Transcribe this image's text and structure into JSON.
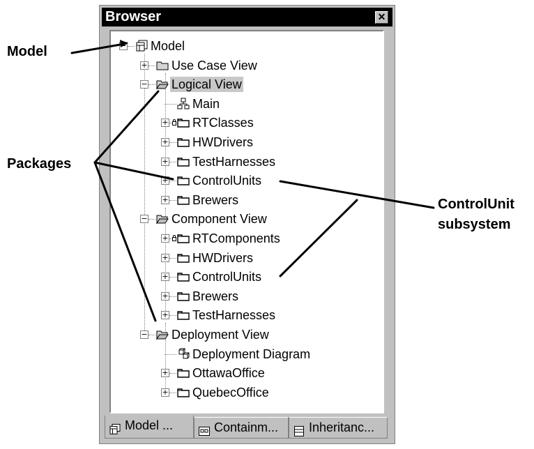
{
  "window": {
    "title": "Browser",
    "close_glyph": "✕"
  },
  "tree": [
    {
      "label": "Model",
      "icon": "model-icon",
      "depth": 0,
      "expander": "−",
      "selected": false
    },
    {
      "label": "Use Case View",
      "icon": "folder-icon",
      "depth": 1,
      "expander": "+",
      "selected": false
    },
    {
      "label": "Logical View",
      "icon": "folder-open-icon",
      "depth": 1,
      "expander": "−",
      "selected": true
    },
    {
      "label": "Main",
      "icon": "class-diagram-icon",
      "depth": 2,
      "expander": "",
      "selected": false
    },
    {
      "label": "RTClasses",
      "icon": "package-icon",
      "depth": 2,
      "expander": "+",
      "selected": false,
      "locked": true
    },
    {
      "label": "HWDrivers",
      "icon": "package-icon",
      "depth": 2,
      "expander": "+",
      "selected": false
    },
    {
      "label": "TestHarnesses",
      "icon": "package-icon",
      "depth": 2,
      "expander": "+",
      "selected": false
    },
    {
      "label": "ControlUnits",
      "icon": "package-icon",
      "depth": 2,
      "expander": "+",
      "selected": false
    },
    {
      "label": "Brewers",
      "icon": "package-icon",
      "depth": 2,
      "expander": "+",
      "selected": false
    },
    {
      "label": "Component View",
      "icon": "folder-open-icon",
      "depth": 1,
      "expander": "−",
      "selected": false
    },
    {
      "label": "RTComponents",
      "icon": "package-icon",
      "depth": 2,
      "expander": "+",
      "selected": false,
      "locked": true
    },
    {
      "label": "HWDrivers",
      "icon": "package-icon",
      "depth": 2,
      "expander": "+",
      "selected": false
    },
    {
      "label": "ControlUnits",
      "icon": "package-icon",
      "depth": 2,
      "expander": "+",
      "selected": false
    },
    {
      "label": "Brewers",
      "icon": "package-icon",
      "depth": 2,
      "expander": "+",
      "selected": false
    },
    {
      "label": "TestHarnesses",
      "icon": "package-icon",
      "depth": 2,
      "expander": "+",
      "selected": false
    },
    {
      "label": "Deployment View",
      "icon": "folder-open-icon",
      "depth": 1,
      "expander": "−",
      "selected": false
    },
    {
      "label": "Deployment Diagram",
      "icon": "deployment-diagram-icon",
      "depth": 2,
      "expander": "",
      "selected": false
    },
    {
      "label": "OttawaOffice",
      "icon": "package-icon",
      "depth": 2,
      "expander": "+",
      "selected": false
    },
    {
      "label": "QuebecOffice",
      "icon": "package-icon",
      "depth": 2,
      "expander": "+",
      "selected": false
    }
  ],
  "tabs": [
    {
      "label": "Model ...",
      "icon": "model-tab-icon",
      "active": true
    },
    {
      "label": "Containm...",
      "icon": "containment-tab-icon",
      "active": false
    },
    {
      "label": "Inheritanc...",
      "icon": "inheritance-tab-icon",
      "active": false
    }
  ],
  "annotations": {
    "model": "Model",
    "packages": "Packages",
    "controlunit_line1": "ControlUnit",
    "controlunit_line2": "subsystem"
  },
  "colors": {
    "titlebar": "#000000",
    "panel": "#c0c0c0",
    "selection": "#c8c8c8"
  }
}
